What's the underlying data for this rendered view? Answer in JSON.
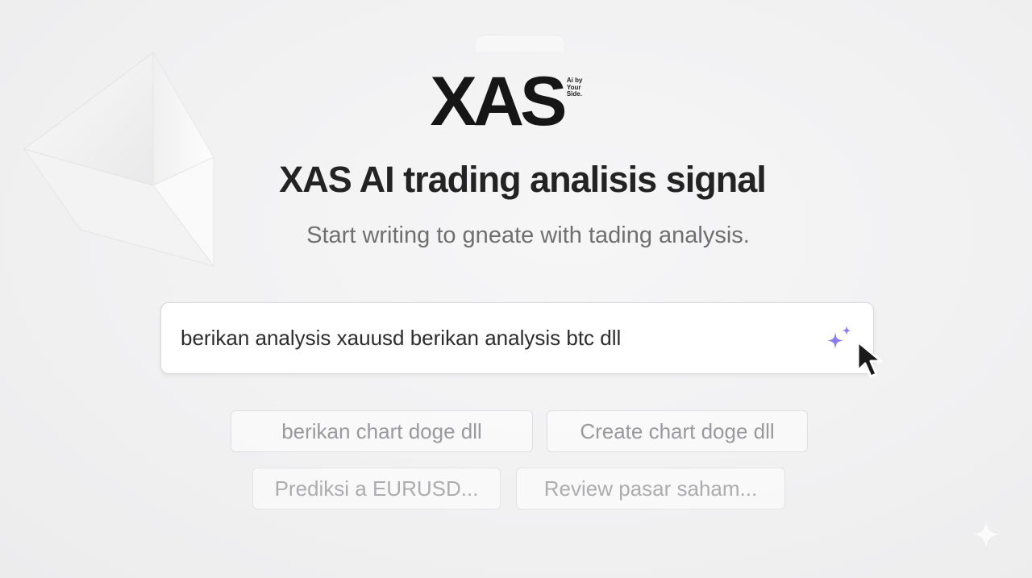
{
  "logo": {
    "wordmark": "XAS",
    "tagline_lines": [
      "Ai by",
      "Your",
      "Side."
    ]
  },
  "headline": "XAS AI trading analisis signal",
  "subtitle": "Start writing to gneate with tading analysis.",
  "search": {
    "value": "berikan analysis xauusd berikan analysis btc dll",
    "action_icon": "sparkle-icon"
  },
  "suggestions": [
    "berikan chart doge dll",
    "Create chart doge dll",
    "Prediksi a EURUSD...",
    "Review pasar saham..."
  ],
  "colors": {
    "accent": "#8b7cf0",
    "text_primary": "#232323",
    "text_muted": "#6f6f6f",
    "chip_text": "#9a9a9c"
  }
}
